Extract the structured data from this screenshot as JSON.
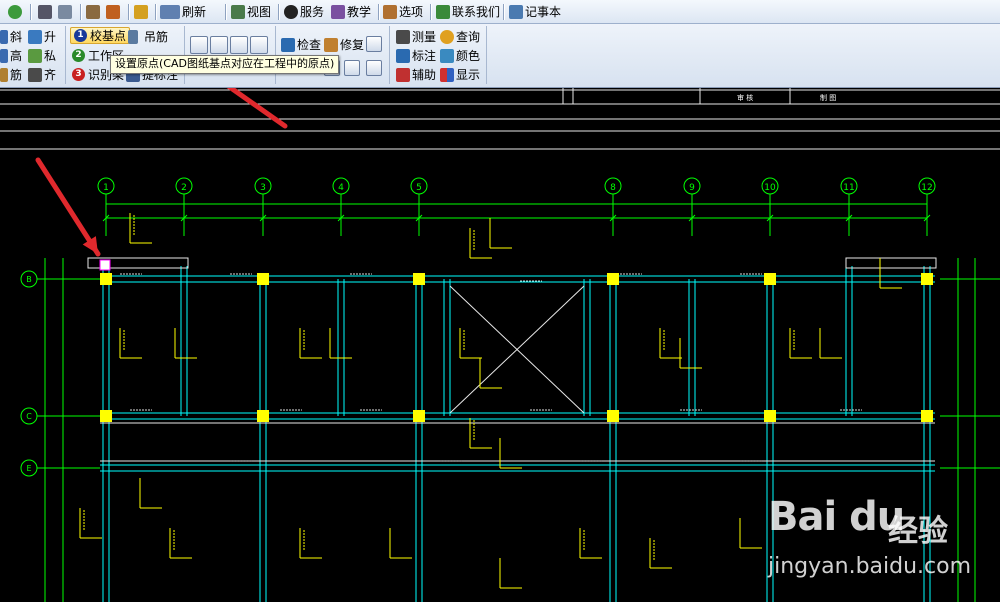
{
  "menubar": {
    "items": [
      "刷新",
      "视图",
      "服务",
      "教学",
      "选项",
      "联系我们",
      "记事本"
    ]
  },
  "ribbon": {
    "col1": [
      "斜",
      "高",
      "筋"
    ],
    "col2": [
      "升",
      "私",
      "齐"
    ],
    "steps": [
      {
        "num": "1",
        "label": "校基点"
      },
      {
        "num": "2",
        "label": "工作区"
      },
      {
        "num": "3",
        "label": "识别梁"
      }
    ],
    "col4": [
      "吊筋",
      "提标注"
    ],
    "view_tools": [
      "检查",
      "修复"
    ],
    "right_a": [
      "测量",
      "标注",
      "辅助"
    ],
    "right_b": [
      "查询",
      "颜色",
      "显示"
    ]
  },
  "tooltip": "设置原点(CAD图纸基点对应在工程中的原点)",
  "cad": {
    "axes_top": [
      "1",
      "2",
      "3",
      "4",
      "5",
      "8",
      "9",
      "10",
      "11",
      "12"
    ],
    "axes_left": [
      "B",
      "C",
      "E"
    ],
    "title_block": [
      "审 核",
      "制 图"
    ],
    "colors": {
      "axis": "#00ff00",
      "beam": "#00ffff",
      "column": "#ffff00",
      "annotation": "#ffff00",
      "wall": "#e8e8e8"
    }
  },
  "watermark": {
    "logo": "Bai du",
    "cn": "经验",
    "url": "jingyan.baidu.com"
  }
}
